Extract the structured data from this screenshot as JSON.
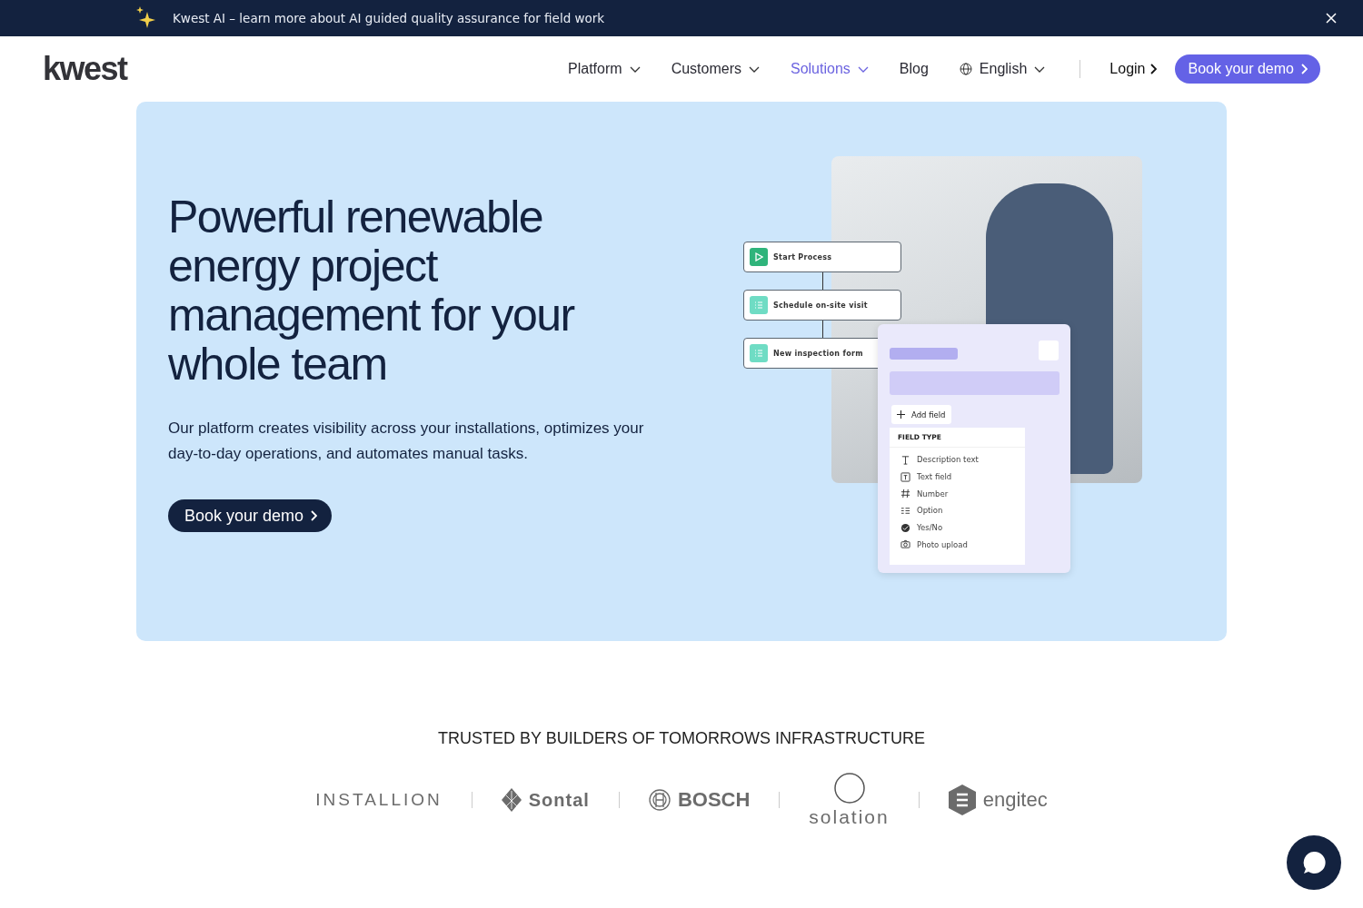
{
  "announcement": {
    "text": "Kwest AI – learn more about AI guided quality assurance for field work"
  },
  "header": {
    "logo": "kwest",
    "nav": [
      {
        "label": "Platform",
        "dropdown": true,
        "selected": false
      },
      {
        "label": "Customers",
        "dropdown": true,
        "selected": false
      },
      {
        "label": "Solutions",
        "dropdown": true,
        "selected": true
      },
      {
        "label": "Blog",
        "dropdown": false,
        "selected": false
      },
      {
        "label": "English",
        "dropdown": true,
        "selected": false,
        "kind": "language"
      }
    ],
    "login": "Login",
    "cta": "Book your demo"
  },
  "hero": {
    "title": "Powerful renewable energy project management for your whole team",
    "subtitle": "Our platform creates visibility across your installations, optimizes your day-to-day operations, and automates manual tasks.",
    "cta": "Book your demo",
    "flow_steps": [
      {
        "label": "Start Process",
        "kind": "start"
      },
      {
        "label": "Schedule on-site visit",
        "kind": "list"
      },
      {
        "label": "New inspection form",
        "kind": "list"
      }
    ],
    "add_field": "Add field",
    "field_type_heading": "FIELD TYPE",
    "field_types": [
      {
        "label": "Description text",
        "kind": "description"
      },
      {
        "label": "Text field",
        "kind": "textfield"
      },
      {
        "label": "Number",
        "kind": "number"
      },
      {
        "label": "Option",
        "kind": "option"
      },
      {
        "label": "Yes/No",
        "kind": "yesno"
      },
      {
        "label": "Photo upload",
        "kind": "photo"
      }
    ]
  },
  "trusted": {
    "heading": "TRUSTED BY BUILDERS OF TOMORROWS INFRASTRUCTURE",
    "logos": [
      {
        "name": "INSTALLION",
        "kind": "installion"
      },
      {
        "name": "Sontal",
        "kind": "sontal"
      },
      {
        "name": "BOSCH",
        "kind": "bosch"
      },
      {
        "name": "solation",
        "kind": "solation"
      },
      {
        "name": "engitec",
        "kind": "engitec"
      }
    ]
  }
}
